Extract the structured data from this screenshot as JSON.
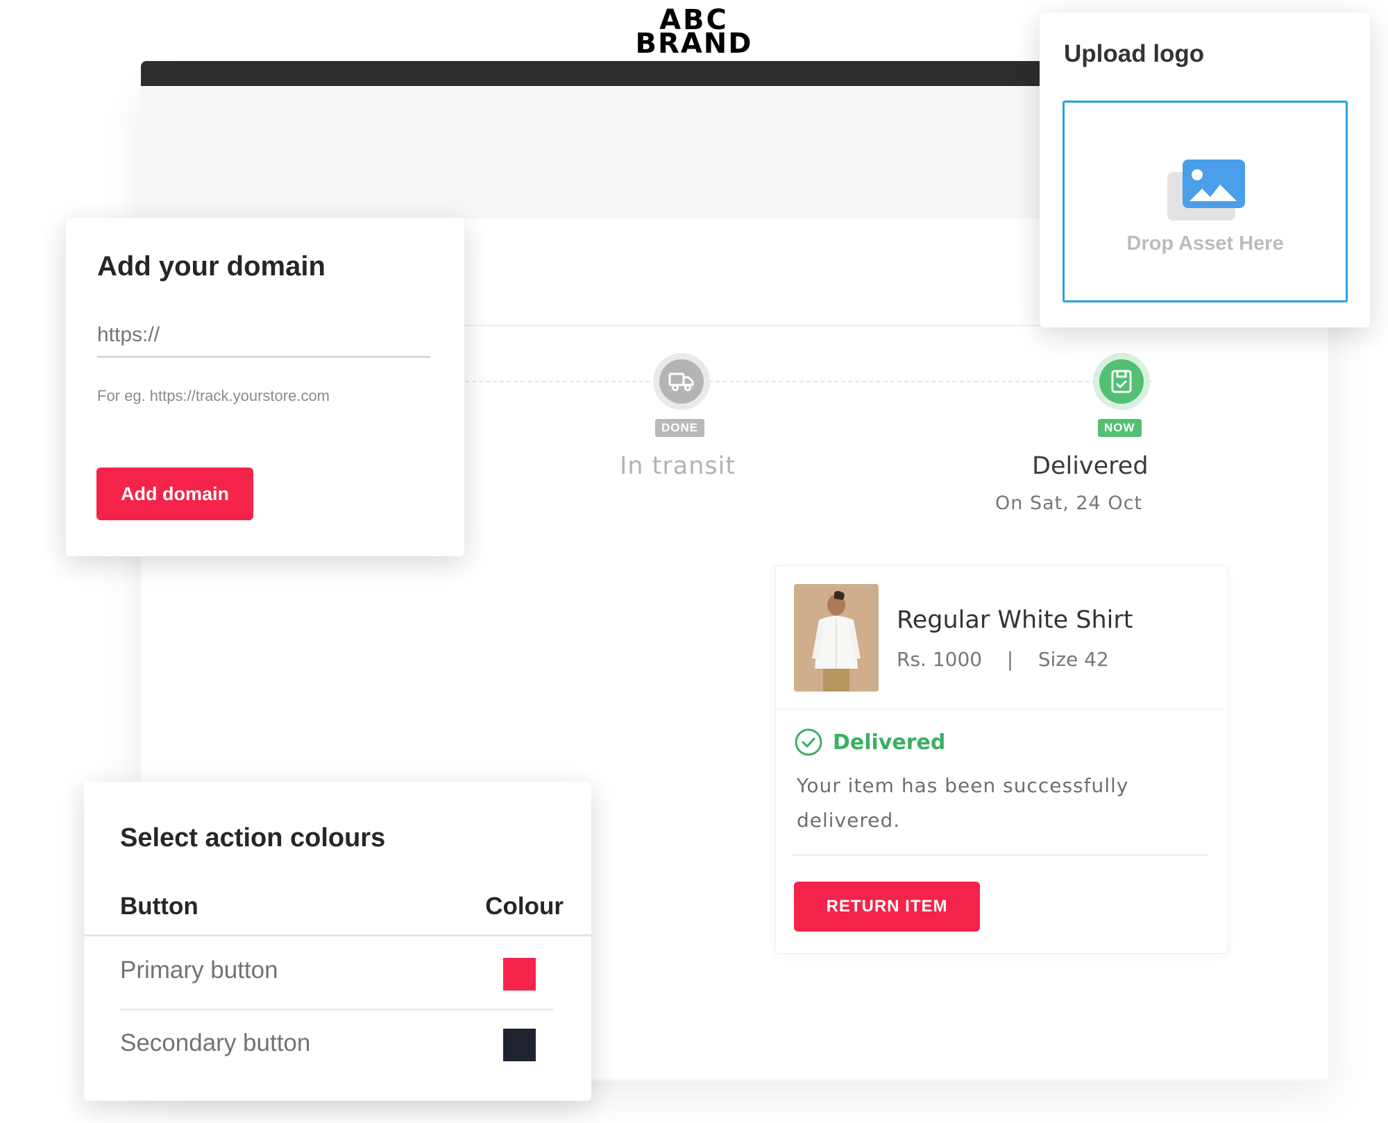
{
  "brand": {
    "line1": "ABC",
    "line2": "BRAND"
  },
  "tracking": {
    "steps": [
      {
        "badge": "DONE",
        "label": "In transit",
        "icon": "truck-icon"
      },
      {
        "badge": "NOW",
        "label": "Delivered",
        "date": "On Sat, 24 Oct",
        "icon": "package-icon"
      }
    ]
  },
  "product": {
    "title": "Regular White Shirt",
    "price": "Rs. 1000",
    "separator": "|",
    "size": "Size 42",
    "status": "Delivered",
    "status_desc": "Your item has been successfully delivered.",
    "return_label": "RETURN ITEM"
  },
  "domain": {
    "title": "Add your domain",
    "input_placeholder": "https://",
    "hint": "For eg. https://track.yourstore.com",
    "button_label": "Add domain"
  },
  "upload": {
    "title": "Upload logo",
    "drop_text": "Drop Asset Here",
    "icon": "image-icon"
  },
  "colours": {
    "title": "Select action colours",
    "col_button": "Button",
    "col_colour": "Colour",
    "rows": [
      {
        "label": "Primary button",
        "color": "#f5234a"
      },
      {
        "label": "Secondary button",
        "color": "#1f2430"
      }
    ]
  },
  "colors": {
    "accent": "#f5234a",
    "success": "#52bf72",
    "upload_border": "#27a1e5"
  }
}
